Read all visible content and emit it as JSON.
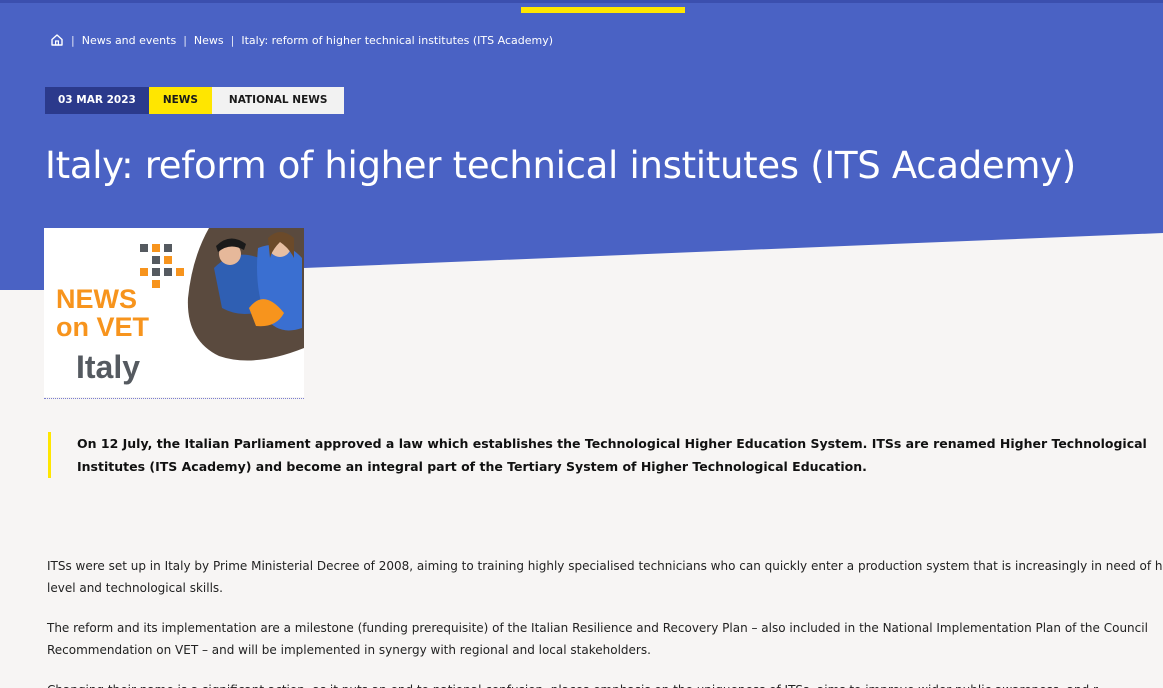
{
  "breadcrumb": {
    "home_icon": "home-icon",
    "items": [
      "News and events",
      "News",
      "Italy: reform of higher technical institutes (ITS Academy)"
    ],
    "separator": "|"
  },
  "tags": {
    "date": "03 MAR 2023",
    "type": "NEWS",
    "category": "NATIONAL NEWS"
  },
  "title": "Italy: reform of higher technical institutes (ITS Academy)",
  "thumbnail": {
    "line1": "NEWS",
    "line2": "on VET",
    "line3": "Italy"
  },
  "lead": "On 12 July, the Italian Parliament approved a law which establishes the Technological Higher Education System. ITSs are renamed Higher Technological Institutes (ITS Academy) and become an integral part of the Tertiary System of Higher Technological Education.",
  "paragraphs": [
    "ITSs were set up in Italy by Prime Ministerial Decree of 2008, aiming to training highly specialised technicians who can quickly enter a production system that is increasingly in need of high-level and technological skills.",
    "The reform and its implementation are a milestone (funding prerequisite) of the Italian Resilience and Recovery Plan – also included in the National Implementation Plan of the Council Recommendation on VET – and will be implemented in synergy with regional and local stakeholders.",
    "Changing their name is a significant action, as it puts an end to national confusion, places emphasis on the uniqueness of ITSs, aims to improve wider public awareness, and r"
  ],
  "colors": {
    "hero": "#4a62c4",
    "accent": "#ffe600",
    "date_tag": "#2b3a8c",
    "thumb_orange": "#f7941d",
    "thumb_grey": "#555a60"
  }
}
